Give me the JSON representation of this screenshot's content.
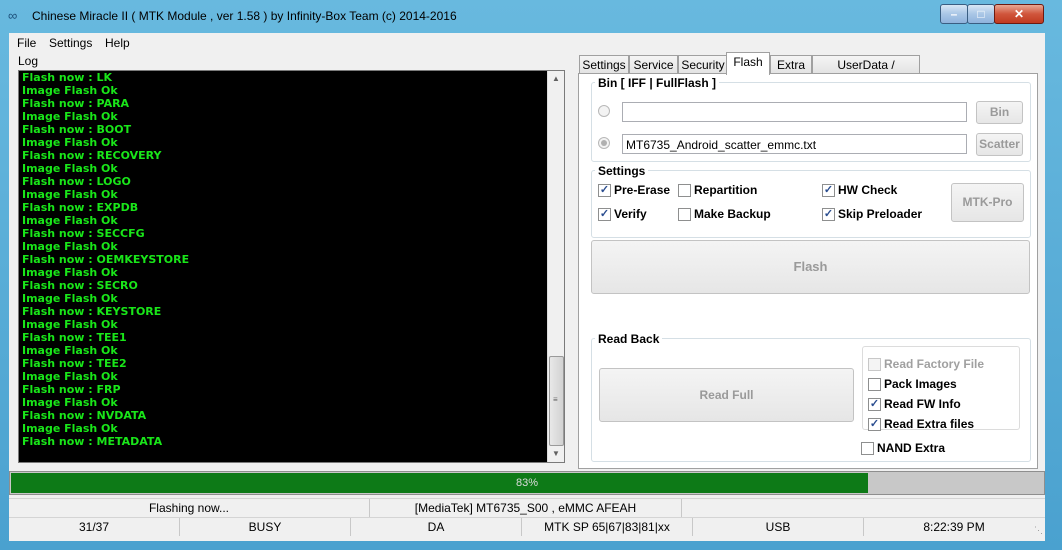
{
  "window": {
    "title": "Chinese Miracle II ( MTK Module , ver 1.58 ) by Infinity-Box Team (c) 2014-2016",
    "min_glyph": "–",
    "max_glyph": "□",
    "close_glyph": "✕"
  },
  "menu": [
    "File",
    "Settings",
    "Help"
  ],
  "log": {
    "label": "Log",
    "lines": [
      "Flash now : LK",
      "Image Flash Ok",
      "Flash now : PARA",
      "Image Flash Ok",
      "Flash now : BOOT",
      "Image Flash Ok",
      "Flash now : RECOVERY",
      "Image Flash Ok",
      "Flash now : LOGO",
      "Image Flash Ok",
      "Flash now : EXPDB",
      "Image Flash Ok",
      "Flash now : SECCFG",
      "Image Flash Ok",
      "Flash now : OEMKEYSTORE",
      "Image Flash Ok",
      "Flash now : SECRO",
      "Image Flash Ok",
      "Flash now : KEYSTORE",
      "Image Flash Ok",
      "Flash now : TEE1",
      "Image Flash Ok",
      "Flash now : TEE2",
      "Image Flash Ok",
      "Flash now : FRP",
      "Image Flash Ok",
      "Flash now : NVDATA",
      "Image Flash Ok",
      "Flash now : METADATA"
    ],
    "text_color": "#19e619"
  },
  "tabs": [
    "Settings",
    "Service",
    "Security",
    "Flash",
    "Extra",
    "UserData / Forensic"
  ],
  "active_tab": "Flash",
  "flash": {
    "bin_group_label": "Bin  [ IFF | FullFlash ]",
    "bin_path": "",
    "bin_button": "Bin",
    "scatter_path": "MT6735_Android_scatter_emmc.txt",
    "scatter_button": "Scatter",
    "settings_label": "Settings",
    "options": {
      "pre_erase": {
        "label": "Pre-Erase",
        "checked": true
      },
      "repartition": {
        "label": "Repartition",
        "checked": false
      },
      "hw_check": {
        "label": "HW Check",
        "checked": true
      },
      "verify": {
        "label": "Verify",
        "checked": true
      },
      "make_backup": {
        "label": "Make Backup",
        "checked": false
      },
      "skip_preloader": {
        "label": "Skip Preloader",
        "checked": true
      }
    },
    "mtk_pro_button": "MTK-Pro",
    "flash_button": "Flash",
    "readback_label": "Read Back",
    "read_full_button": "Read Full",
    "readback_options": {
      "read_factory_file": {
        "label": "Read Factory File",
        "checked": false,
        "disabled": true
      },
      "pack_images": {
        "label": "Pack Images",
        "checked": false
      },
      "read_fw_info": {
        "label": "Read FW Info",
        "checked": true
      },
      "read_extra_files": {
        "label": "Read Extra files",
        "checked": true
      }
    },
    "nand_extra": {
      "label": "NAND Extra",
      "checked": false
    }
  },
  "progress": {
    "text": "83%",
    "value": 0.83,
    "color": "#0d7a17"
  },
  "status_row1": [
    "Flashing now...",
    "[MediaTek] MT6735_S00 , eMMC AFEAH",
    ""
  ],
  "status_row2": [
    "31/37",
    "BUSY",
    "DA",
    "MTK SP 65|67|83|81|xx",
    "USB",
    "8:22:39 PM"
  ]
}
